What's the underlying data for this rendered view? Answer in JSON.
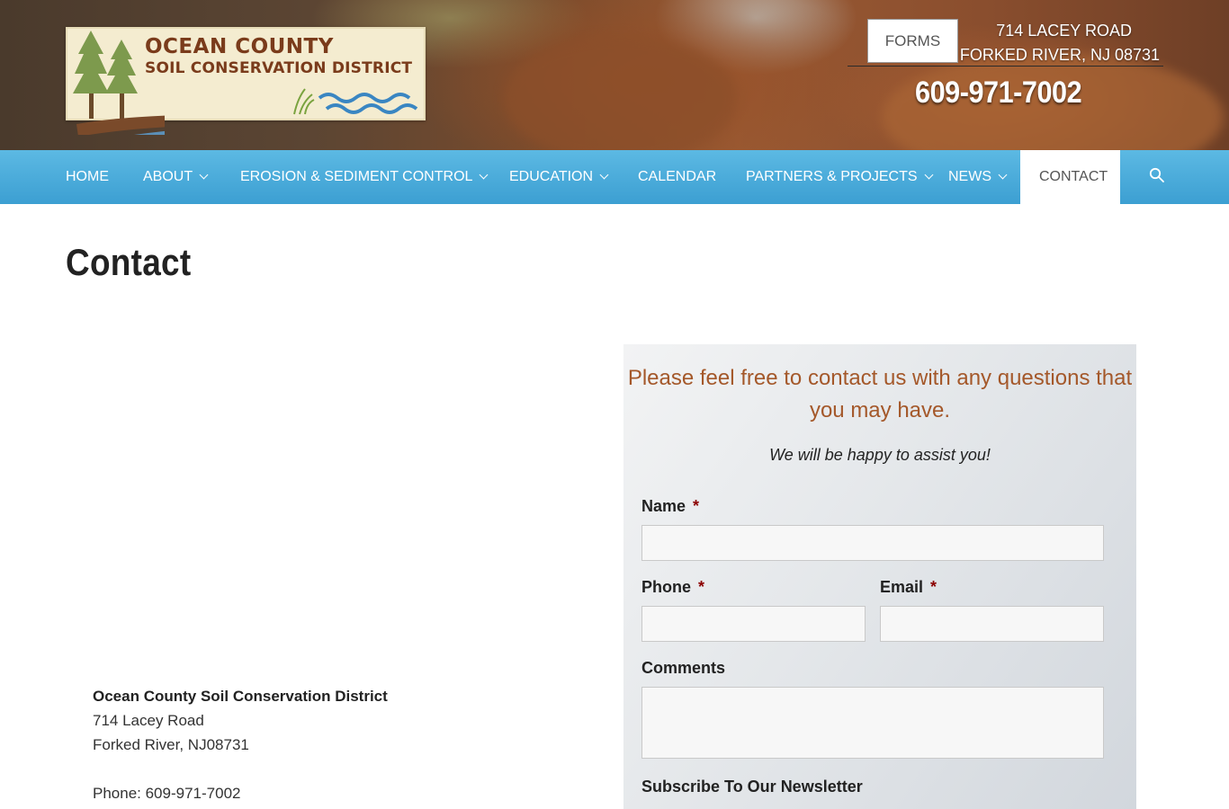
{
  "header": {
    "logo": {
      "line1": "OCEAN COUNTY",
      "line2": "SOIL CONSERVATION DISTRICT"
    },
    "forms_label": "FORMS",
    "address_line1": "714 LACEY ROAD",
    "address_line2": "FORKED RIVER, NJ 08731",
    "phone": "609-971-7002"
  },
  "nav": {
    "items": [
      {
        "label": "HOME",
        "dropdown": false
      },
      {
        "label": "ABOUT",
        "dropdown": true
      },
      {
        "label": "EROSION & SEDIMENT CONTROL",
        "dropdown": true
      },
      {
        "label": "EDUCATION",
        "dropdown": true
      },
      {
        "label": "CALENDAR",
        "dropdown": false
      },
      {
        "label": "PARTNERS & PROJECTS",
        "dropdown": true
      },
      {
        "label": "NEWS",
        "dropdown": true
      },
      {
        "label": "CONTACT",
        "dropdown": false,
        "active": true
      }
    ],
    "search_icon": "search-icon",
    "color": "#4aabda"
  },
  "page": {
    "title": "Contact"
  },
  "contact_info": {
    "name": "Ocean County Soil Conservation District",
    "street": "714 Lacey Road",
    "city": "Forked River, NJ08731",
    "phone": "Phone: 609-971-7002"
  },
  "form": {
    "heading": "Please feel free to contact us with any questions that you may have.",
    "subheading": "We will be happy to assist you!",
    "required_mark": "*",
    "fields": {
      "name_label": "Name",
      "phone_label": "Phone",
      "email_label": "Email",
      "comments_label": "Comments",
      "newsletter_label": "Subscribe To Our Newsletter"
    },
    "accent_color": "#a4582a"
  }
}
